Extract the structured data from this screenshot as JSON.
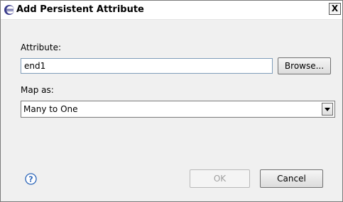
{
  "dialog": {
    "title": "Add Persistent Attribute",
    "close_glyph": "X"
  },
  "form": {
    "attribute_label": "Attribute:",
    "attribute_value": "end1",
    "browse_label": "Browse...",
    "map_as_label": "Map as:",
    "map_as_selected": "Many to One"
  },
  "footer": {
    "ok_label": "OK",
    "cancel_label": "Cancel",
    "help_icon": "help-icon"
  },
  "colors": {
    "dialog_bg": "#f0f0f0",
    "title_bar_bg": "#ffffff",
    "input_border": "#7f9db9",
    "disabled_text": "#a0a0a0",
    "help_icon_blue": "#2a64b8"
  }
}
